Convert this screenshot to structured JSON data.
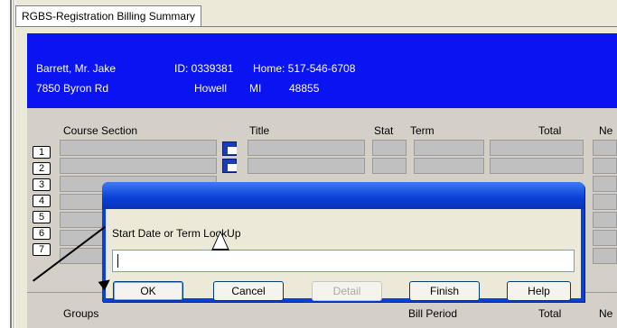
{
  "tab": {
    "label": "RGBS-Registration Billing Summary"
  },
  "header": {
    "name": "Barrett, Mr. Jake",
    "id": "ID: 0339381",
    "home": "Home: 517-546-6708",
    "address": "7850 Byron Rd",
    "city": "Howell",
    "state": "MI",
    "zip": "48855"
  },
  "grid": {
    "columns": [
      "Course Section",
      "Title",
      "Stat",
      "Term",
      "Total",
      "Ne"
    ],
    "rows": [
      "1",
      "2",
      "3",
      "4",
      "5",
      "6",
      "7"
    ]
  },
  "lower": {
    "groups_label": "Groups",
    "bill_period_label": "Bill Period",
    "total_label": "Total",
    "ne_label": "Ne"
  },
  "dialog": {
    "prompt": "Start Date or Term LookUp",
    "input_value": "",
    "buttons": {
      "ok": "OK",
      "cancel": "Cancel",
      "detail": "Detail",
      "finish": "Finish",
      "help": "Help"
    }
  }
}
